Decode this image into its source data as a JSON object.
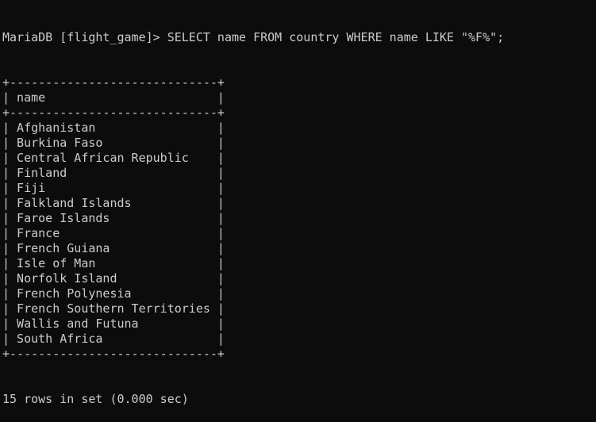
{
  "terminal": {
    "prompt": "MariaDB [flight_game]> ",
    "command": "SELECT name FROM country WHERE name LIKE \"%F%\";",
    "table": {
      "column": "name",
      "rows": [
        "Afghanistan",
        "Burkina Faso",
        "Central African Republic",
        "Finland",
        "Fiji",
        "Falkland Islands",
        "Faroe Islands",
        "France",
        "French Guiana",
        "Isle of Man",
        "Norfolk Island",
        "French Polynesia",
        "French Southern Territories",
        "Wallis and Futuna",
        "South Africa"
      ]
    },
    "result_summary": "15 rows in set (0.000 sec)"
  }
}
